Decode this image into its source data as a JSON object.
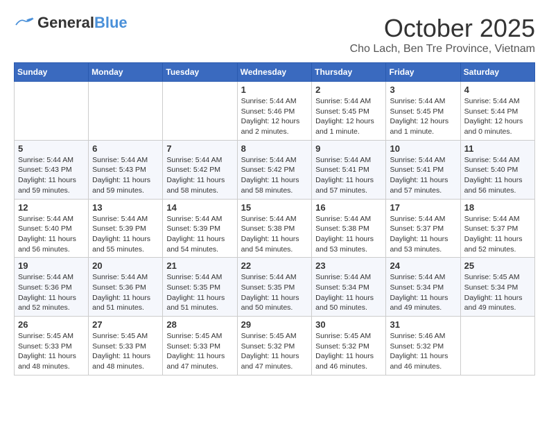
{
  "header": {
    "logo_general": "General",
    "logo_blue": "Blue",
    "month": "October 2025",
    "location": "Cho Lach, Ben Tre Province, Vietnam"
  },
  "weekdays": [
    "Sunday",
    "Monday",
    "Tuesday",
    "Wednesday",
    "Thursday",
    "Friday",
    "Saturday"
  ],
  "weeks": [
    [
      {
        "day": "",
        "info": ""
      },
      {
        "day": "",
        "info": ""
      },
      {
        "day": "",
        "info": ""
      },
      {
        "day": "1",
        "info": "Sunrise: 5:44 AM\nSunset: 5:46 PM\nDaylight: 12 hours and 2 minutes."
      },
      {
        "day": "2",
        "info": "Sunrise: 5:44 AM\nSunset: 5:45 PM\nDaylight: 12 hours and 1 minute."
      },
      {
        "day": "3",
        "info": "Sunrise: 5:44 AM\nSunset: 5:45 PM\nDaylight: 12 hours and 1 minute."
      },
      {
        "day": "4",
        "info": "Sunrise: 5:44 AM\nSunset: 5:44 PM\nDaylight: 12 hours and 0 minutes."
      }
    ],
    [
      {
        "day": "5",
        "info": "Sunrise: 5:44 AM\nSunset: 5:43 PM\nDaylight: 11 hours and 59 minutes."
      },
      {
        "day": "6",
        "info": "Sunrise: 5:44 AM\nSunset: 5:43 PM\nDaylight: 11 hours and 59 minutes."
      },
      {
        "day": "7",
        "info": "Sunrise: 5:44 AM\nSunset: 5:42 PM\nDaylight: 11 hours and 58 minutes."
      },
      {
        "day": "8",
        "info": "Sunrise: 5:44 AM\nSunset: 5:42 PM\nDaylight: 11 hours and 58 minutes."
      },
      {
        "day": "9",
        "info": "Sunrise: 5:44 AM\nSunset: 5:41 PM\nDaylight: 11 hours and 57 minutes."
      },
      {
        "day": "10",
        "info": "Sunrise: 5:44 AM\nSunset: 5:41 PM\nDaylight: 11 hours and 57 minutes."
      },
      {
        "day": "11",
        "info": "Sunrise: 5:44 AM\nSunset: 5:40 PM\nDaylight: 11 hours and 56 minutes."
      }
    ],
    [
      {
        "day": "12",
        "info": "Sunrise: 5:44 AM\nSunset: 5:40 PM\nDaylight: 11 hours and 56 minutes."
      },
      {
        "day": "13",
        "info": "Sunrise: 5:44 AM\nSunset: 5:39 PM\nDaylight: 11 hours and 55 minutes."
      },
      {
        "day": "14",
        "info": "Sunrise: 5:44 AM\nSunset: 5:39 PM\nDaylight: 11 hours and 54 minutes."
      },
      {
        "day": "15",
        "info": "Sunrise: 5:44 AM\nSunset: 5:38 PM\nDaylight: 11 hours and 54 minutes."
      },
      {
        "day": "16",
        "info": "Sunrise: 5:44 AM\nSunset: 5:38 PM\nDaylight: 11 hours and 53 minutes."
      },
      {
        "day": "17",
        "info": "Sunrise: 5:44 AM\nSunset: 5:37 PM\nDaylight: 11 hours and 53 minutes."
      },
      {
        "day": "18",
        "info": "Sunrise: 5:44 AM\nSunset: 5:37 PM\nDaylight: 11 hours and 52 minutes."
      }
    ],
    [
      {
        "day": "19",
        "info": "Sunrise: 5:44 AM\nSunset: 5:36 PM\nDaylight: 11 hours and 52 minutes."
      },
      {
        "day": "20",
        "info": "Sunrise: 5:44 AM\nSunset: 5:36 PM\nDaylight: 11 hours and 51 minutes."
      },
      {
        "day": "21",
        "info": "Sunrise: 5:44 AM\nSunset: 5:35 PM\nDaylight: 11 hours and 51 minutes."
      },
      {
        "day": "22",
        "info": "Sunrise: 5:44 AM\nSunset: 5:35 PM\nDaylight: 11 hours and 50 minutes."
      },
      {
        "day": "23",
        "info": "Sunrise: 5:44 AM\nSunset: 5:34 PM\nDaylight: 11 hours and 50 minutes."
      },
      {
        "day": "24",
        "info": "Sunrise: 5:44 AM\nSunset: 5:34 PM\nDaylight: 11 hours and 49 minutes."
      },
      {
        "day": "25",
        "info": "Sunrise: 5:45 AM\nSunset: 5:34 PM\nDaylight: 11 hours and 49 minutes."
      }
    ],
    [
      {
        "day": "26",
        "info": "Sunrise: 5:45 AM\nSunset: 5:33 PM\nDaylight: 11 hours and 48 minutes."
      },
      {
        "day": "27",
        "info": "Sunrise: 5:45 AM\nSunset: 5:33 PM\nDaylight: 11 hours and 48 minutes."
      },
      {
        "day": "28",
        "info": "Sunrise: 5:45 AM\nSunset: 5:33 PM\nDaylight: 11 hours and 47 minutes."
      },
      {
        "day": "29",
        "info": "Sunrise: 5:45 AM\nSunset: 5:32 PM\nDaylight: 11 hours and 47 minutes."
      },
      {
        "day": "30",
        "info": "Sunrise: 5:45 AM\nSunset: 5:32 PM\nDaylight: 11 hours and 46 minutes."
      },
      {
        "day": "31",
        "info": "Sunrise: 5:46 AM\nSunset: 5:32 PM\nDaylight: 11 hours and 46 minutes."
      },
      {
        "day": "",
        "info": ""
      }
    ]
  ]
}
